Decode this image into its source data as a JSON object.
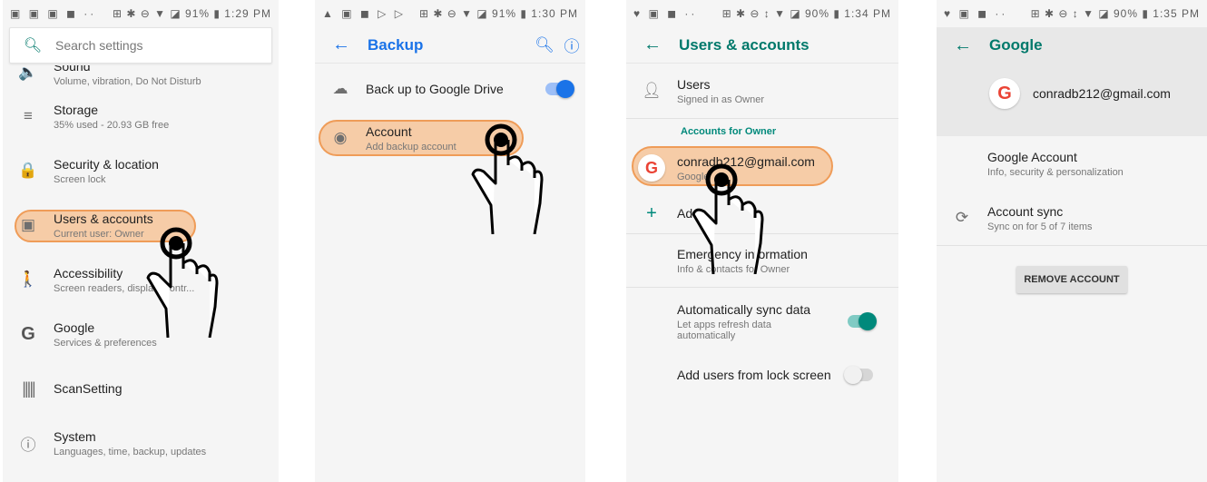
{
  "screen1": {
    "status": {
      "left": "▣ ▣ ▣ ◼ ··",
      "right": "⊞ ✱ ⊖ ▼ ◪ 91% ▮ 1:29 PM"
    },
    "search_placeholder": "Search settings",
    "items": [
      {
        "title": "Sound",
        "subtitle": "Volume, vibration, Do Not Disturb",
        "icon": "volume-icon",
        "glyph": "🔈"
      },
      {
        "title": "Storage",
        "subtitle": "35% used - 20.93 GB free",
        "icon": "storage-icon",
        "glyph": "≡"
      },
      {
        "title": "Security & location",
        "subtitle": "Screen lock",
        "icon": "lock-icon",
        "glyph": "🔒"
      },
      {
        "title": "Users & accounts",
        "subtitle": "Current user: Owner",
        "icon": "account-box-icon",
        "glyph": "▣"
      },
      {
        "title": "Accessibility",
        "subtitle": "Screen readers, display, interaction controls",
        "subtitle_shown": "Screen readers, displa        n contr...",
        "icon": "accessibility-icon",
        "glyph": "🚶"
      },
      {
        "title": "Google",
        "subtitle": "Services & preferences",
        "icon": "google-g-icon",
        "glyph": "G"
      },
      {
        "title": "ScanSetting",
        "subtitle": "",
        "icon": "barcode-icon",
        "glyph": "⦀"
      },
      {
        "title": "System",
        "subtitle": "Languages, time, backup, updates",
        "icon": "info-icon",
        "glyph": "ⓘ"
      }
    ]
  },
  "screen2": {
    "status": {
      "left": "▲ ▣ ◼ ▷ ▷",
      "right": "⊞ ✱ ⊖ ▼ ◪ 91% ▮ 1:30 PM"
    },
    "title": "Backup",
    "backup_drive": {
      "title": "Back up to Google Drive",
      "enabled": true
    },
    "account": {
      "title": "Account",
      "subtitle": "Add backup account"
    }
  },
  "screen3": {
    "status": {
      "left": "♥ ▣ ◼ ··",
      "right": "⊞ ✱ ⊖ ↕ ▼ ◪ 90% ▮ 1:34 PM"
    },
    "title": "Users & accounts",
    "users": {
      "title": "Users",
      "subtitle": "Signed in as Owner"
    },
    "section": "Accounts for Owner",
    "google_account": {
      "title": "conradb212@gmail.com",
      "subtitle": "Google"
    },
    "add": {
      "title": "Add account",
      "shown": "Add"
    },
    "emergency": {
      "title": "Emergency information",
      "subtitle": "Info & contacts for Owner"
    },
    "auto_sync": {
      "title": "Automatically sync data",
      "subtitle": "Let apps refresh data automatically",
      "enabled": true
    },
    "lock_screen": {
      "title": "Add users from lock screen",
      "enabled": false
    }
  },
  "screen4": {
    "status": {
      "left": "♥ ▣ ◼ ··",
      "right": "⊞ ✱ ⊖ ↕ ▼ ◪ 90% ▮ 1:35 PM"
    },
    "title": "Google",
    "email": "conradb212@gmail.com",
    "google_account": {
      "title": "Google Account",
      "subtitle": "Info, security & personalization"
    },
    "sync": {
      "title": "Account sync",
      "subtitle": "Sync on for 5 of 7 items"
    },
    "remove_button": "REMOVE ACCOUNT"
  },
  "colors": {
    "teal": "#00796b",
    "blue": "#1a73e8",
    "highlight": "#f6bd8c",
    "highlight_border": "#ef9c58"
  }
}
